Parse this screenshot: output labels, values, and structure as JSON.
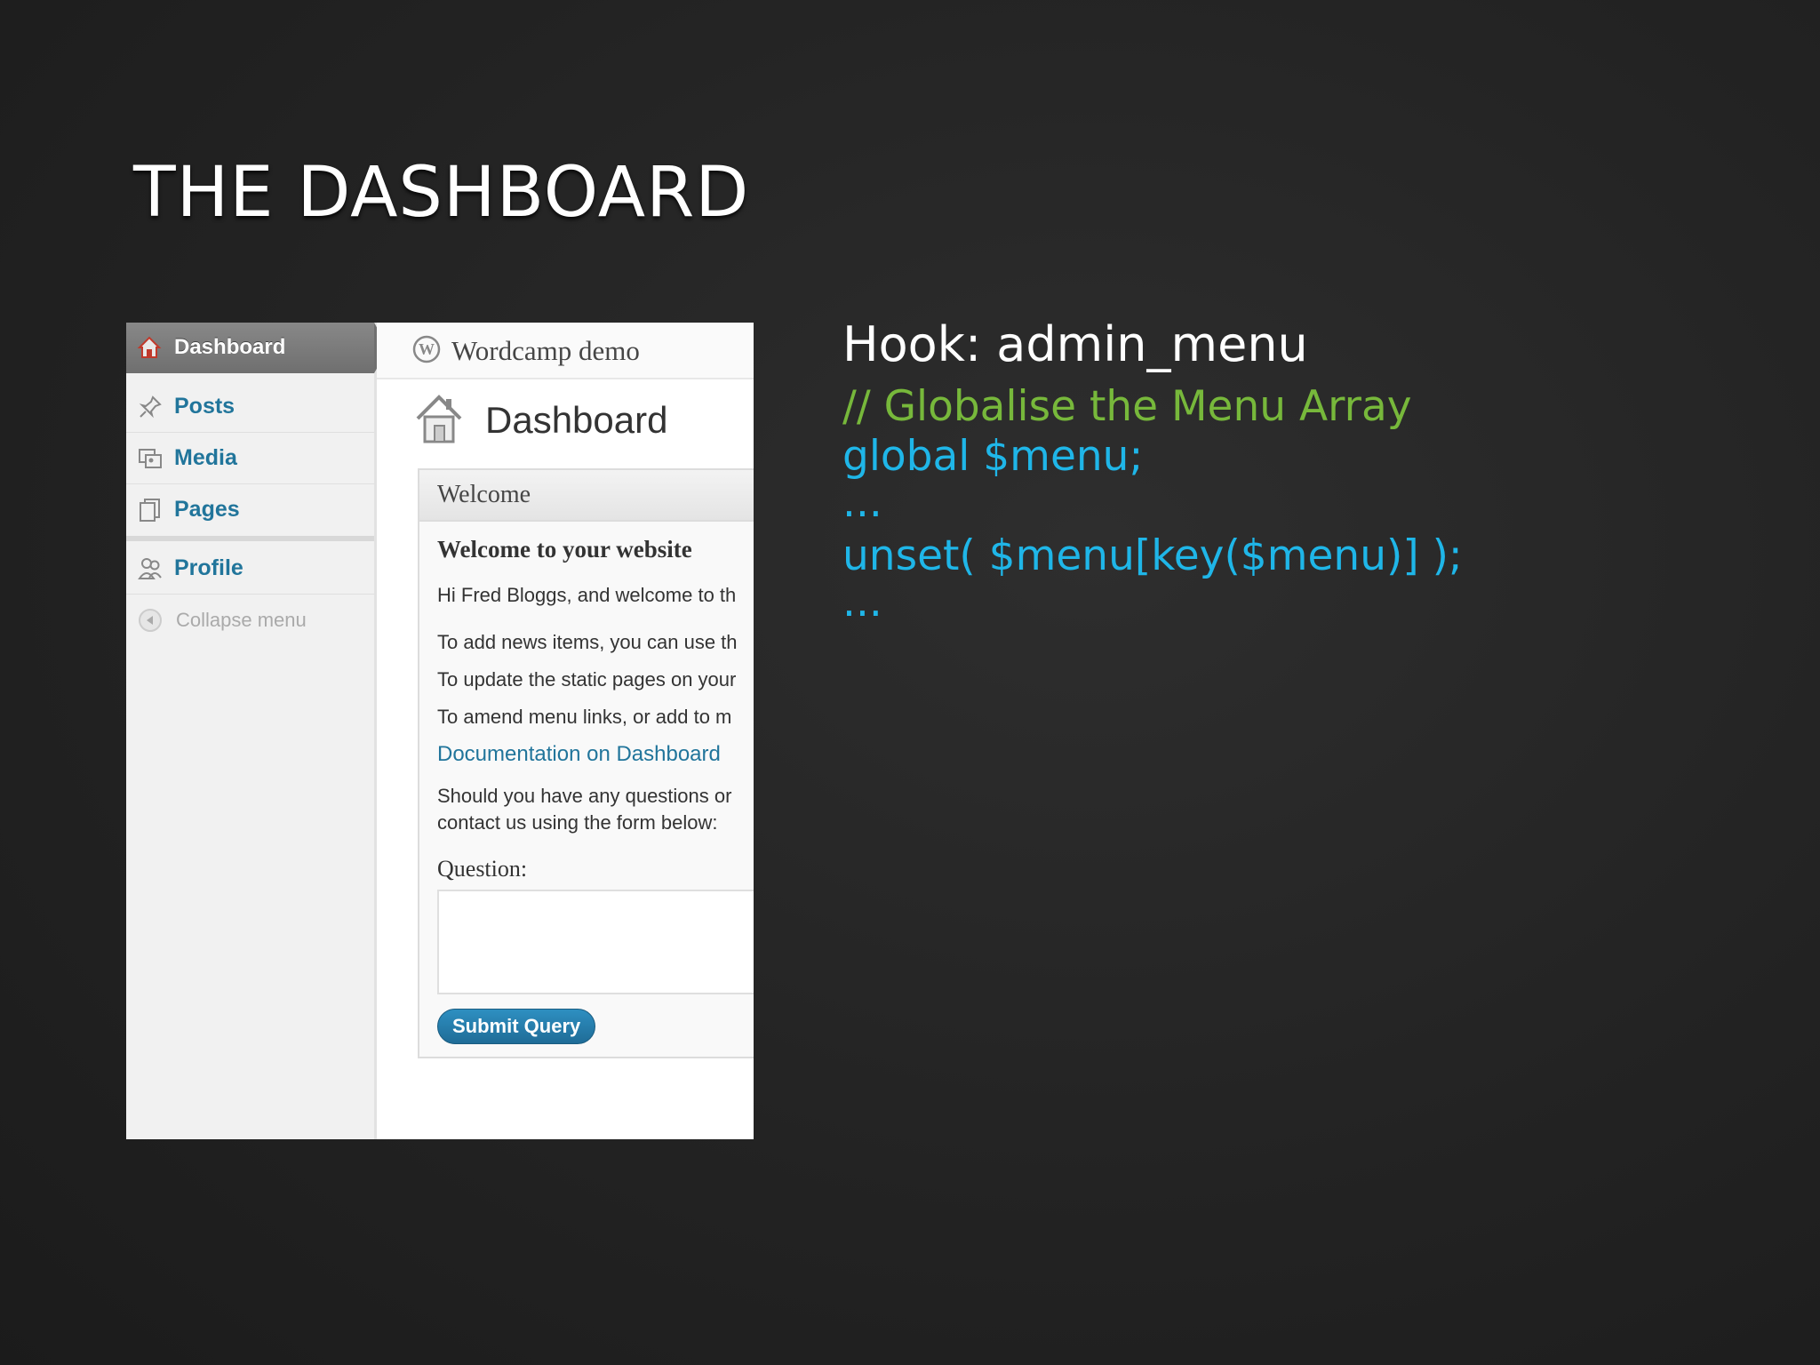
{
  "slide": {
    "title": "THE DASHBOARD"
  },
  "screenshot": {
    "sidebar": {
      "active": "Dashboard",
      "items": [
        {
          "label": "Posts",
          "icon": "pin-icon"
        },
        {
          "label": "Media",
          "icon": "media-icon"
        },
        {
          "label": "Pages",
          "icon": "pages-icon"
        },
        {
          "label": "Profile",
          "icon": "users-icon"
        }
      ],
      "collapse": "Collapse menu"
    },
    "site_title": "Wordcamp demo",
    "page_title": "Dashboard",
    "widget": {
      "title": "Welcome",
      "heading": "Welcome to your website",
      "lines": [
        "Hi Fred Bloggs, and welcome to th",
        "To add news items, you can use th",
        "To update the static pages on your",
        "To amend menu links, or add to m"
      ],
      "doc_link": "Documentation on Dashboard",
      "questions_1": "Should you have any questions or",
      "questions_2": "contact us using the form below:",
      "question_label": "Question:",
      "question_value": "",
      "submit_label": "Submit Query"
    }
  },
  "code": {
    "hook": "Hook: admin_menu",
    "comment": "// Globalise the Menu Array",
    "line1": "global $menu;",
    "ellipsis1": "...",
    "line2": "unset( $menu[key($menu)] );",
    "ellipsis2": "..."
  },
  "colors": {
    "comment": "#77b83b",
    "code": "#1fb6e8",
    "link": "#21759b"
  }
}
